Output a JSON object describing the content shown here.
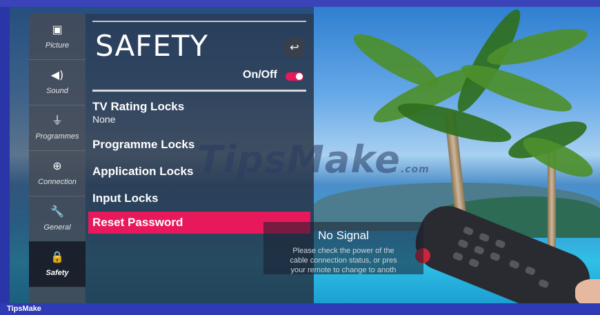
{
  "sidebar": {
    "items": [
      {
        "label": "Picture",
        "icon": "picture-icon",
        "glyph": "▣"
      },
      {
        "label": "Sound",
        "icon": "speaker-icon",
        "glyph": "◀)"
      },
      {
        "label": "Programmes",
        "icon": "antenna-icon",
        "glyph": "⏚"
      },
      {
        "label": "Connection",
        "icon": "globe-icon",
        "glyph": "⊕"
      },
      {
        "label": "General",
        "icon": "wrench-icon",
        "glyph": "🔧"
      },
      {
        "label": "Safety",
        "icon": "lock-icon",
        "glyph": "🔒"
      }
    ],
    "active": "Safety"
  },
  "panel": {
    "title": "SAFETY",
    "back_glyph": "↩",
    "onoff_label": "On/Off",
    "onoff_state": true,
    "items": [
      {
        "label": "TV Rating Locks",
        "sub": "None"
      },
      {
        "label": "Programme Locks"
      },
      {
        "label": "Application Locks"
      },
      {
        "label": "Input Locks"
      },
      {
        "label": "Reset Password",
        "selected": true
      }
    ]
  },
  "no_signal": {
    "title": "No Signal",
    "lines": [
      "Please check the power of the",
      "cable connection status, or pres",
      "your remote to change to anoth"
    ]
  },
  "watermark": {
    "text": "TipsMake",
    "suffix": ".com"
  },
  "footer": {
    "brand": "TipsMake"
  },
  "colors": {
    "accent": "#e8195a",
    "frame": "#2f3bb5"
  }
}
